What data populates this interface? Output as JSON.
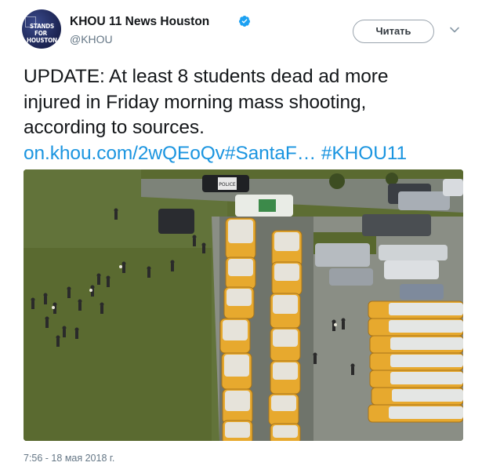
{
  "account": {
    "name": "KHOU 11 News Houston",
    "handle": "@KHOU",
    "avatar_text": [
      "STANDS",
      "FOR",
      "HOUSTON"
    ]
  },
  "actions": {
    "follow_label": "Читать"
  },
  "tweet": {
    "lines": [
      "UPDATE: At least 8 students dead ad more",
      "injured in Friday morning mass shooting,",
      "according to sources."
    ],
    "link_text": "on.khou.com/2wQEoQv",
    "hashtags": [
      "#SantaF…",
      "#KHOU11"
    ],
    "timestamp": "7:56 - 18 мая 2018 г."
  },
  "media": {
    "police_label": "POLICE"
  },
  "colors": {
    "link": "#1b95e0",
    "verified": "#1da1f2"
  }
}
